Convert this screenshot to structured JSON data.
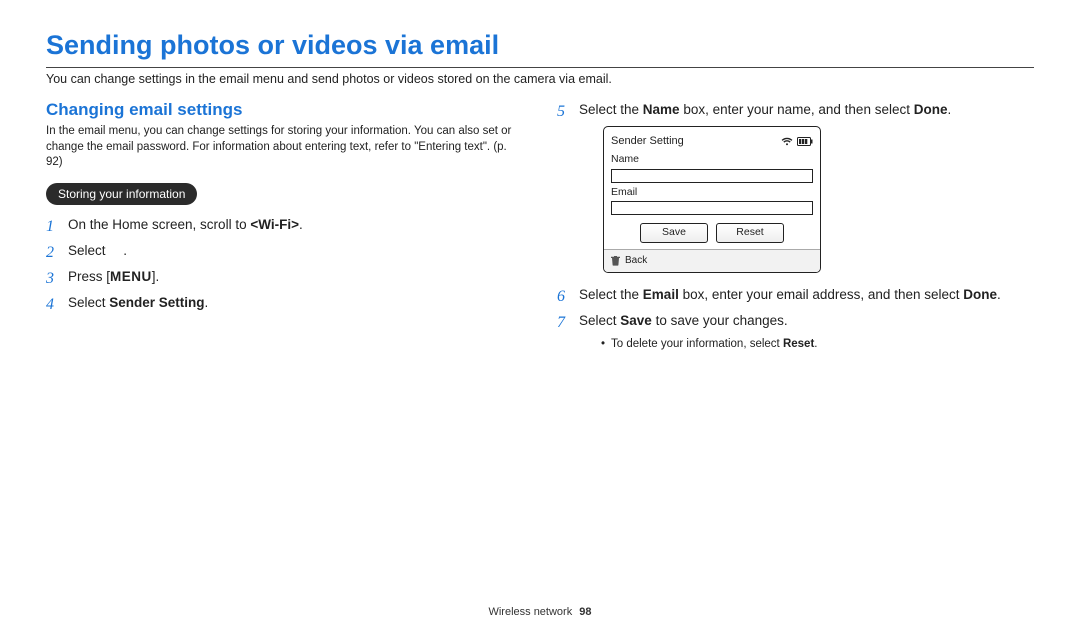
{
  "title": "Sending photos or videos via email",
  "intro": "You can change settings in the email menu and send photos or videos stored on the camera via email.",
  "left": {
    "subhead": "Changing email settings",
    "desc": "In the email menu, you can change settings for storing your information. You can also set or change the email password. For information about entering text, refer to \"Entering text\". (p. 92)",
    "pill": "Storing your information",
    "steps": {
      "s1_a": "On the Home screen, scroll to ",
      "s1_b": "<Wi-Fi>",
      "s1_c": ".",
      "s2_a": "Select ",
      "s2_b": ".",
      "s3_a": "Press [",
      "s3_b": "MENU",
      "s3_c": "].",
      "s4_a": "Select ",
      "s4_b": "Sender Setting",
      "s4_c": "."
    }
  },
  "right": {
    "steps": {
      "s5_a": "Select the ",
      "s5_b": "Name",
      "s5_c": " box, enter your name, and then select ",
      "s5_d": "Done",
      "s5_e": ".",
      "s6_a": "Select the ",
      "s6_b": "Email",
      "s6_c": " box, enter your email address, and then select ",
      "s6_d": "Done",
      "s6_e": ".",
      "s7_a": "Select ",
      "s7_b": "Save",
      "s7_c": " to save your changes.",
      "bullet_a": "To delete your information, select ",
      "bullet_b": "Reset",
      "bullet_c": "."
    }
  },
  "device": {
    "title": "Sender Setting",
    "name_label": "Name",
    "email_label": "Email",
    "save": "Save",
    "reset": "Reset",
    "back": "Back"
  },
  "footer": {
    "section": "Wireless network",
    "page": "98"
  }
}
